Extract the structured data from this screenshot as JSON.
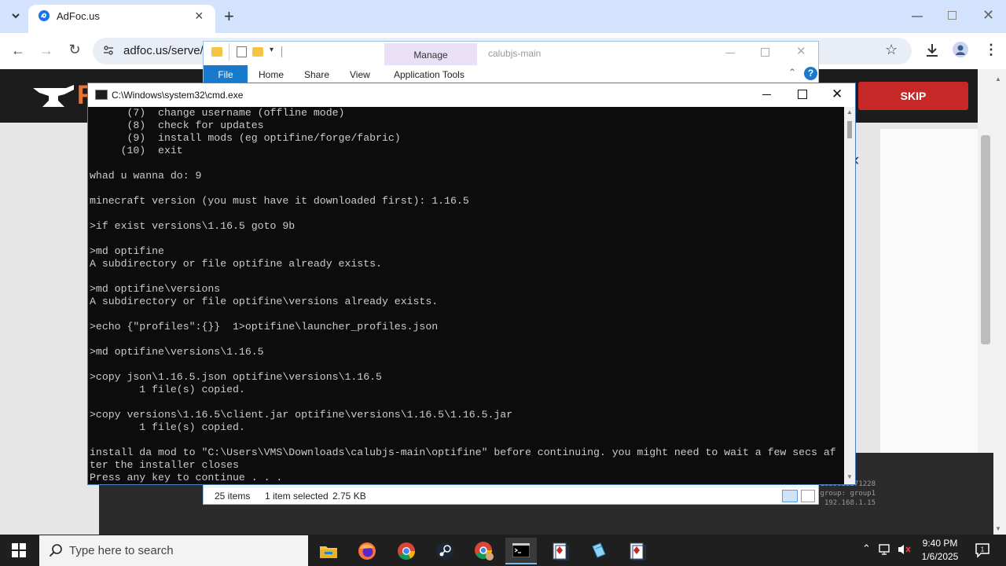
{
  "browser": {
    "tab_title": "AdFoc.us",
    "url": "adfoc.us/serve/?",
    "new_tab": "+",
    "close_tab": "×"
  },
  "page": {
    "logo_letter": "F",
    "skip_label": "SKIP",
    "net_info": [
      "1335022271228",
      "group: group1",
      "IP: 192.168.1.15"
    ]
  },
  "explorer": {
    "manage_label": "Manage",
    "title": "calubjs-main",
    "tabs": [
      "File",
      "Home",
      "Share",
      "View",
      "Application Tools"
    ],
    "status_items": "25 items",
    "status_selected": "1 item selected",
    "status_size": "2.75 KB"
  },
  "cmd": {
    "title": "C:\\Windows\\system32\\cmd.exe",
    "lines": [
      "      (7)  change username (offline mode)",
      "      (8)  check for updates",
      "      (9)  install mods (eg optifine/forge/fabric)",
      "     (10)  exit",
      "",
      "whad u wanna do: 9",
      "",
      "minecraft version (you must have it downloaded first): 1.16.5",
      "",
      ">if exist versions\\1.16.5 goto 9b",
      "",
      ">md optifine",
      "A subdirectory or file optifine already exists.",
      "",
      ">md optifine\\versions",
      "A subdirectory or file optifine\\versions already exists.",
      "",
      ">echo {\"profiles\":{}}  1>optifine\\launcher_profiles.json",
      "",
      ">md optifine\\versions\\1.16.5",
      "",
      ">copy json\\1.16.5.json optifine\\versions\\1.16.5",
      "        1 file(s) copied.",
      "",
      ">copy versions\\1.16.5\\client.jar optifine\\versions\\1.16.5\\1.16.5.jar",
      "        1 file(s) copied.",
      "",
      "install da mod to \"C:\\Users\\VMS\\Downloads\\calubjs-main\\optifine\" before continuing. you might need to wait a few secs af",
      "ter the installer closes",
      "Press any key to continue . . ."
    ]
  },
  "taskbar": {
    "search_placeholder": "Type here to search",
    "time": "9:40 PM",
    "date": "1/6/2025"
  },
  "colors": {
    "accent_blue": "#1979ca",
    "skip_red": "#c62828",
    "cmd_bg": "#0c0c0c",
    "cmd_fg": "#cccccc"
  }
}
